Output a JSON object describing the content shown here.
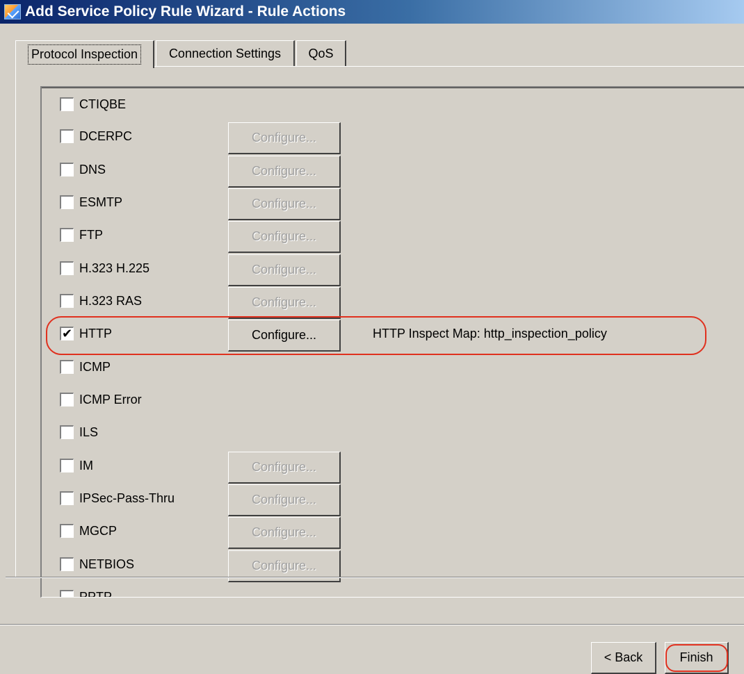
{
  "window": {
    "title": "Add Service Policy Rule Wizard - Rule Actions"
  },
  "tabs": [
    {
      "label": "Protocol Inspection"
    },
    {
      "label": "Connection Settings"
    },
    {
      "label": "QoS"
    }
  ],
  "protocols": [
    {
      "label": "CTIQBE",
      "checked": false,
      "configure": null
    },
    {
      "label": "DCERPC",
      "checked": false,
      "configure": "Configure..."
    },
    {
      "label": "DNS",
      "checked": false,
      "configure": "Configure..."
    },
    {
      "label": "ESMTP",
      "checked": false,
      "configure": "Configure..."
    },
    {
      "label": "FTP",
      "checked": false,
      "configure": "Configure..."
    },
    {
      "label": "H.323 H.225",
      "checked": false,
      "configure": "Configure..."
    },
    {
      "label": "H.323 RAS",
      "checked": false,
      "configure": "Configure..."
    },
    {
      "label": "HTTP",
      "checked": true,
      "configure": "Configure...",
      "info": "HTTP Inspect Map: http_inspection_policy"
    },
    {
      "label": "ICMP",
      "checked": false,
      "configure": null
    },
    {
      "label": "ICMP Error",
      "checked": false,
      "configure": null
    },
    {
      "label": "ILS",
      "checked": false,
      "configure": null
    },
    {
      "label": "IM",
      "checked": false,
      "configure": "Configure..."
    },
    {
      "label": "IPSec-Pass-Thru",
      "checked": false,
      "configure": "Configure..."
    },
    {
      "label": "MGCP",
      "checked": false,
      "configure": "Configure..."
    },
    {
      "label": "NETBIOS",
      "checked": false,
      "configure": "Configure..."
    },
    {
      "label": "PPTP",
      "checked": false,
      "configure": null
    }
  ],
  "buttons": {
    "back": "< Back",
    "finish": "Finish"
  },
  "colors": {
    "highlight": "#e0301e",
    "background": "#d4d0c8"
  }
}
